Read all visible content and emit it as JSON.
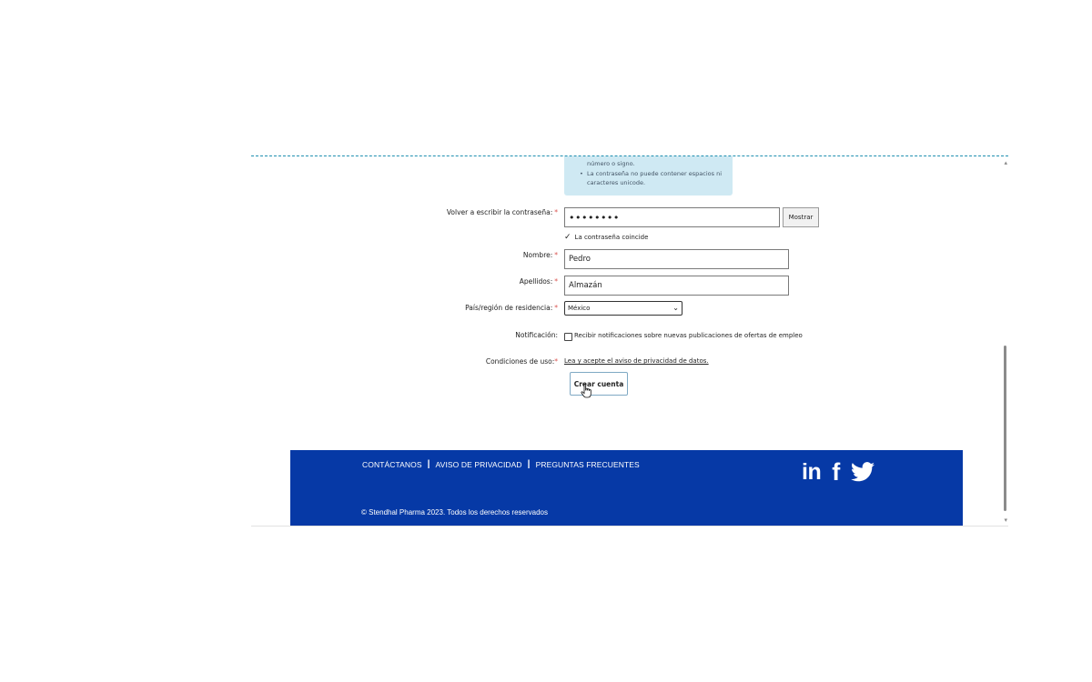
{
  "password_hints": {
    "line1": "número o signo.",
    "line2": "La contraseña no puede contener espacios ni",
    "line3": "caracteres unicode."
  },
  "form": {
    "confirm_password": {
      "label": "Volver a escribir la contraseña:",
      "required_mark": "*",
      "value": "••••••••",
      "show_button": "Mostrar"
    },
    "match_message": "La contraseña coincide",
    "first_name": {
      "label": "Nombre:",
      "required_mark": "*",
      "value": "Pedro"
    },
    "last_name": {
      "label": "Apellidos:",
      "required_mark": "*",
      "value": "Almazán"
    },
    "country": {
      "label": "País/región de residencia:",
      "required_mark": "*",
      "selected": "México"
    },
    "notification": {
      "label": "Notificación:",
      "checkbox_label": "Recibir notificaciones sobre nuevas publicaciones de ofertas de empleo",
      "checked": false
    },
    "terms": {
      "label": "Condiciones de uso:",
      "required_mark": "*",
      "link": "Lea y acepte el aviso de privacidad de datos."
    },
    "submit": "Crear cuenta"
  },
  "footer": {
    "links": [
      "CONTÁCTANOS",
      "AVISO DE PRIVACIDAD",
      "PREGUNTAS FRECUENTES"
    ],
    "separator": "|",
    "copyright": "© Stendhal Pharma 2023. Todos los derechos reservados",
    "social": {
      "linkedin": "in",
      "facebook": "f"
    }
  },
  "colors": {
    "footer_bg": "#0639a6",
    "hint_bg": "#cfe9f3",
    "required": "#d9534f"
  }
}
